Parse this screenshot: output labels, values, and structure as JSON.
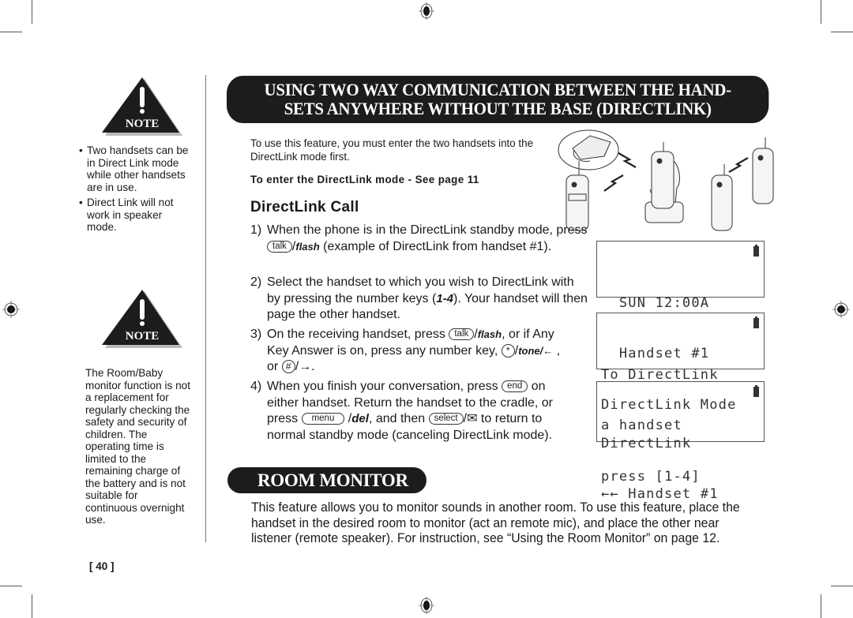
{
  "main_banner": {
    "line1": "USING TWO WAY COMMUNICATION BETWEEN THE HAND-",
    "line2": "SETS ANYWHERE WITHOUT THE BASE (DIRECTLINK)"
  },
  "notes": [
    {
      "label": "NOTE",
      "bullets": [
        "Two handsets can be in Direct Link mode while other handsets are in use.",
        "Direct Link will not work in speaker mode."
      ]
    },
    {
      "label": "NOTE",
      "text": "The Room/Baby monitor function is not a replacement for regularly checking the safety and security of children. The operating time is limited to the remaining charge of the battery and is not suitable for continuous overnight use."
    }
  ],
  "intro": {
    "text": "To use this feature, you must enter the two handsets into the DirectLink mode first.",
    "subheading": "To enter the DirectLink mode - See page 11"
  },
  "directlink_call": {
    "title": "DirectLink Call",
    "steps": [
      {
        "num": "1)",
        "a": "When the phone is in the DirectLink standby mode, press",
        "key1": "talk",
        "key1_suffix": "flash",
        "b": "(example of DirectLink from handset #1)."
      },
      {
        "num": "2)",
        "a": "Select the handset to which you wish to DirectLink with by pressing the number keys (",
        "keys": "1-4",
        "b": "). Your handset will then page the other handset."
      },
      {
        "num": "3)",
        "a": "On the receiving handset, press",
        "key1": "talk",
        "key1_suffix": "flash",
        "b": ", or if Any Key Answer is on, press any number key,",
        "key2": "*",
        "key2_suffix": "tone/←",
        "c": ", or",
        "key3": "#",
        "key3_suffix": "→",
        "d": "."
      },
      {
        "num": "4)",
        "a": "When you finish your conversation, press",
        "key1": "end",
        "b": "on either handset. Return the handset to the cradle, or press",
        "key2": "menu",
        "key2_suffix": "del",
        "c": ", and then",
        "key3": "select",
        "key3_suffix": "✉",
        "d": "to return to normal standby mode (canceling DirectLink mode)."
      }
    ]
  },
  "lcd_screens": [
    {
      "lines": [
        "  SUN 12:00A",
        "  Handset #1",
        "DirectLink Mode"
      ],
      "battery": true
    },
    {
      "lines": [
        "To DirectLink",
        "a handset",
        "press [1-4]"
      ],
      "battery": true
    },
    {
      "lines": [
        "DirectLink",
        "←← Handset #1",
        ""
      ],
      "battery": true
    }
  ],
  "room_monitor": {
    "title": "ROOM MONITOR",
    "text": "This feature allows you to monitor sounds in another room. To use this feature, place the handset in the desired room to monitor (act an remote mic), and place the other near listener (remote speaker). For instruction, see “Using the Room Monitor” on page 12."
  },
  "page_number": "[ 40 ]",
  "illustration": {
    "description": "base phone and handsets communicating wirelessly"
  }
}
